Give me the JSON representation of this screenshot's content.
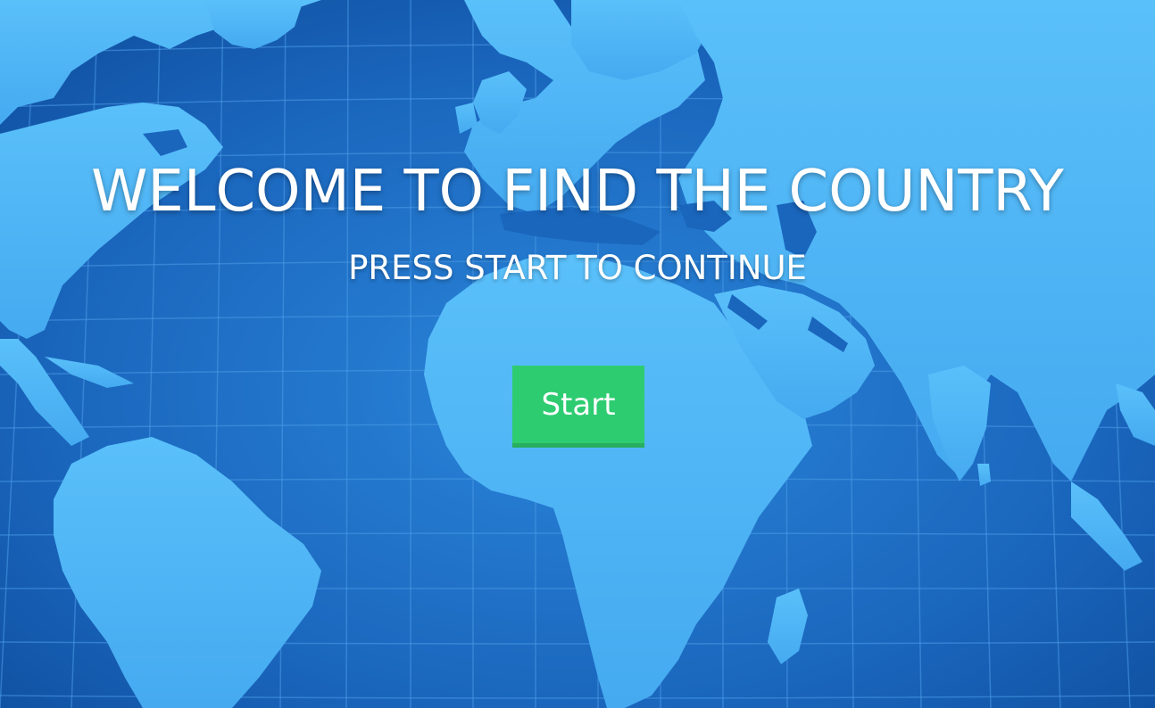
{
  "title": "WELCOME TO FIND THE COUNTRY",
  "subtitle": "PRESS START TO CONTINUE",
  "start_button_label": "Start",
  "colors": {
    "ocean_dark": "#0f57b0",
    "ocean_mid": "#1e73cc",
    "land": "#4fb4f5",
    "grid": "#3a8fe0",
    "button": "#2ecc71",
    "button_shadow": "#27ae60",
    "text": "#ffffff"
  }
}
